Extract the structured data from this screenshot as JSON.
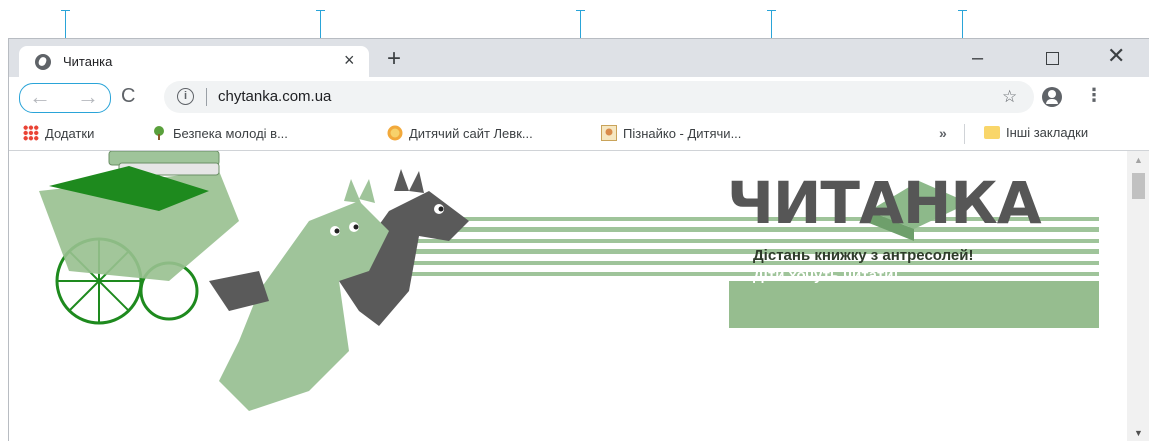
{
  "tab": {
    "title": "Читанка",
    "close": "×"
  },
  "newtab": "+",
  "window_controls": {
    "minimize": "–",
    "close": "✕"
  },
  "toolbar": {
    "back": "←",
    "forward": "→",
    "reload": "C",
    "url": "chytanka.com.ua",
    "info": "i",
    "star": "☆",
    "menu": "⋮"
  },
  "bookmarks": [
    {
      "label": "Додатки",
      "icon": "apps-icon"
    },
    {
      "label": "Безпека молоді в...",
      "icon": "tree-icon"
    },
    {
      "label": "Дитячий сайт Левк...",
      "icon": "lion-icon"
    },
    {
      "label": "Пізнайко - Дитячи...",
      "icon": "pic-icon"
    }
  ],
  "more_bookmarks": "»",
  "other_bookmarks": "Інші закладки",
  "banner": {
    "title": "ЧИТАНКА",
    "slogan": "Дістань книжку з антресолей!",
    "subtitle": "Діти хочуть читати!"
  },
  "colors": {
    "accent": "#2aa4d8",
    "green": "#96bd8f",
    "dark_green": "#2a8a2a"
  }
}
